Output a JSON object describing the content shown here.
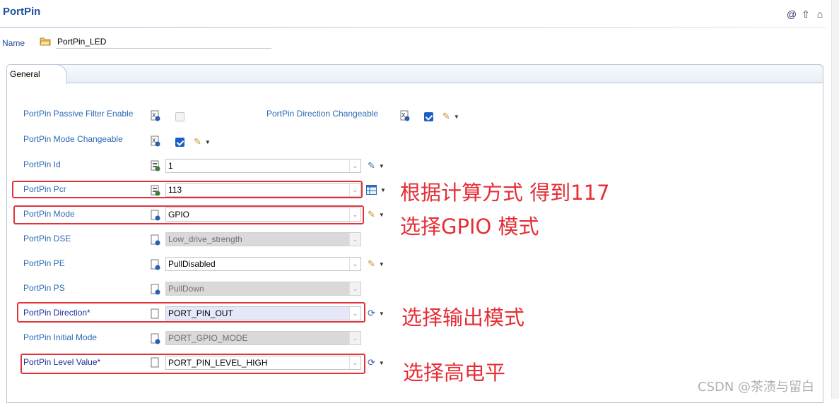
{
  "header": {
    "title": "PortPin"
  },
  "top_icons": [
    "at-icon",
    "up-arrow-icon",
    "home-icon"
  ],
  "name_row": {
    "label": "Name",
    "value": "PortPin_LED"
  },
  "tabs": [
    {
      "label": "General"
    }
  ],
  "params": {
    "passive_filter": {
      "label": "PortPin Passive Filter Enable",
      "checked": false
    },
    "direction_changeable": {
      "label": "PortPin Direction Changeable",
      "checked": true
    },
    "mode_changeable": {
      "label": "PortPin Mode Changeable",
      "checked": true
    },
    "id": {
      "label": "PortPin Id",
      "value": "1"
    },
    "pcr": {
      "label": "PortPin Pcr",
      "value": "113"
    },
    "mode": {
      "label": "PortPin Mode",
      "value": "GPIO"
    },
    "dse": {
      "label": "PortPin DSE",
      "value": "Low_drive_strength"
    },
    "pe": {
      "label": "PortPin PE",
      "value": "PullDisabled"
    },
    "ps": {
      "label": "PortPin PS",
      "value": "PullDown"
    },
    "direction": {
      "label": "PortPin Direction*",
      "value": "PORT_PIN_OUT"
    },
    "initial_mode": {
      "label": "PortPin Initial Mode",
      "value": "PORT_GPIO_MODE"
    },
    "level_value": {
      "label": "PortPin Level Value*",
      "value": "PORT_PIN_LEVEL_HIGH"
    }
  },
  "annotations": {
    "pcr": "根据计算方式 得到117",
    "mode": "选择GPIO 模式",
    "direction": "选择输出模式",
    "level": "选择高电平"
  },
  "watermark": "CSDN @茶渍与留白",
  "colors": {
    "label_blue": "#2a6ab5",
    "annotation_red": "#e52e36",
    "checkbox_blue": "#1a5fc5"
  }
}
